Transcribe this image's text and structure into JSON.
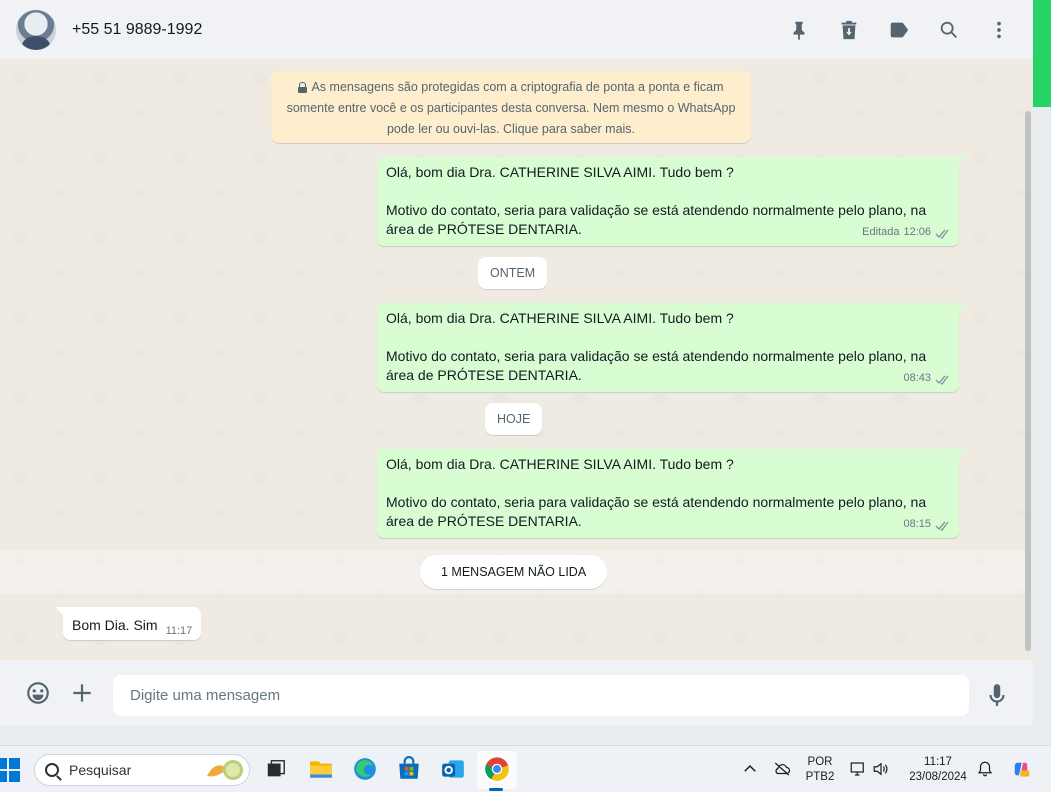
{
  "header": {
    "contact_name": "+55 51 9889-1992",
    "actions": [
      "pin-icon",
      "delete-icon",
      "label-icon",
      "search-icon",
      "menu-icon"
    ]
  },
  "chat": {
    "encryption_notice": "As mensagens são protegidas com a criptografia de ponta a ponta e ficam somente entre você e os participantes desta conversa. Nem mesmo o WhatsApp pode ler ou ouvi-las. Clique para saber mais.",
    "messages": [
      {
        "line1": "Olá, bom dia Dra. CATHERINE SILVA AIMI. Tudo bem ?",
        "line2": "Motivo do contato, seria para validação se está atendendo normalmente pelo plano, na área de PRÓTESE DENTARIA.",
        "edited": "Editada",
        "time": "12:06"
      },
      {
        "line1": "Olá, bom dia Dra. CATHERINE SILVA AIMI. Tudo bem ?",
        "line2": "Motivo do contato, seria para validação se está atendendo normalmente pelo plano, na área de PRÓTESE DENTARIA.",
        "time": "08:43"
      },
      {
        "line1": "Olá, bom dia Dra. CATHERINE SILVA AIMI. Tudo bem ?",
        "line2": "Motivo do contato, seria para validação se está atendendo normalmente pelo plano, na área de PRÓTESE DENTARIA.",
        "time": "08:15"
      }
    ],
    "date_yesterday": "ONTEM",
    "date_today": "HOJE",
    "unread_label": "1 MENSAGEM NÃO LIDA",
    "incoming": {
      "text": "Bom Dia. Sim",
      "time": "11:17"
    }
  },
  "composer": {
    "placeholder": "Digite uma mensagem"
  },
  "taskbar": {
    "search_label": "Pesquisar",
    "language_line1": "POR",
    "language_line2": "PTB2",
    "time": "11:17",
    "date": "23/08/2024"
  },
  "colors": {
    "outgoing_bubble": "#d9fdd3",
    "incoming_bubble": "#ffffff",
    "encryption_bg": "#ffeecd",
    "whatsapp_green": "#25d366",
    "read_ticks": "#8696a0"
  }
}
